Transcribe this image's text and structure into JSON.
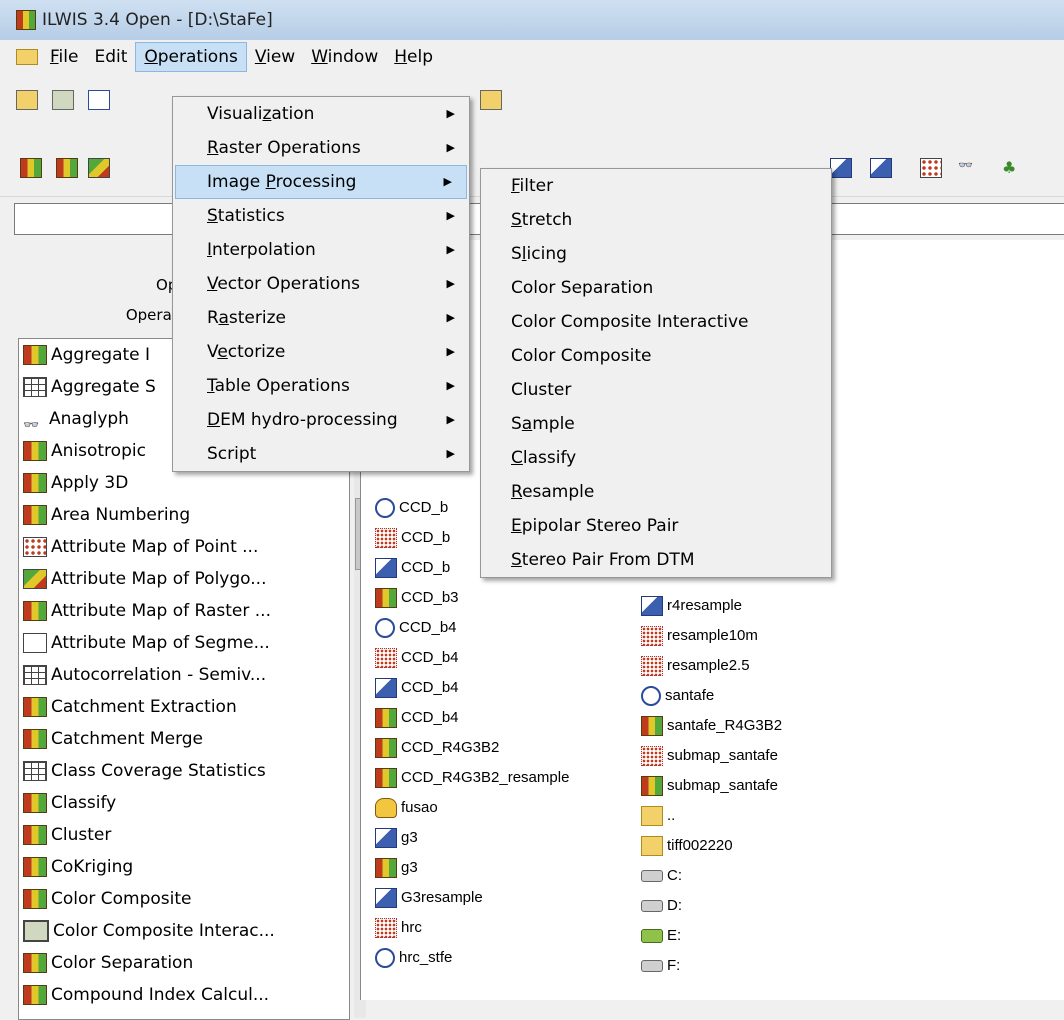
{
  "window": {
    "title": "ILWIS 3.4 Open - [D:\\StaFe]"
  },
  "menubar": [
    {
      "label": "File",
      "u": "F"
    },
    {
      "label": "Edit",
      "u": ""
    },
    {
      "label": "Operations",
      "u": "O"
    },
    {
      "label": "View",
      "u": "V"
    },
    {
      "label": "Window",
      "u": "W"
    },
    {
      "label": "Help",
      "u": "H"
    }
  ],
  "left_panel": {
    "title_partial": "Opera",
    "subtitle_partial": "Operation-List",
    "items": [
      {
        "label": "Aggregate I",
        "icon": "raster-icon"
      },
      {
        "label": "Aggregate S",
        "icon": "table-icon"
      },
      {
        "label": "Anaglyph",
        "icon": "glasses-icon"
      },
      {
        "label": "Anisotropic",
        "icon": "raster-icon"
      },
      {
        "label": "Apply 3D",
        "icon": "raster-icon"
      },
      {
        "label": "Area Numbering",
        "icon": "raster-icon"
      },
      {
        "label": "Attribute Map of Point ...",
        "icon": "point-icon"
      },
      {
        "label": "Attribute Map of Polygo...",
        "icon": "polygon-icon"
      },
      {
        "label": "Attribute Map of Raster ...",
        "icon": "raster-icon"
      },
      {
        "label": "Attribute Map of Segme...",
        "icon": "segment-icon"
      },
      {
        "label": "Autocorrelation - Semiv...",
        "icon": "table-icon"
      },
      {
        "label": "Catchment Extraction",
        "icon": "raster-icon"
      },
      {
        "label": "Catchment Merge",
        "icon": "raster-icon"
      },
      {
        "label": "Class Coverage Statistics",
        "icon": "table-icon"
      },
      {
        "label": "Classify",
        "icon": "raster-icon"
      },
      {
        "label": "Cluster",
        "icon": "raster-icon"
      },
      {
        "label": "CoKriging",
        "icon": "raster-icon"
      },
      {
        "label": "Color Composite",
        "icon": "raster-icon"
      },
      {
        "label": "Color Composite Interac...",
        "icon": "monitor-icon"
      },
      {
        "label": "Color Separation",
        "icon": "raster-icon"
      },
      {
        "label": "Compound Index Calcul...",
        "icon": "raster-icon"
      }
    ]
  },
  "catalog": {
    "col1": [
      {
        "label": "CCD_b",
        "icon": "georef-icon"
      },
      {
        "label": "CCD_b",
        "icon": "pattern-icon"
      },
      {
        "label": "CCD_b",
        "icon": "dem-icon"
      },
      {
        "label": "CCD_b3",
        "icon": "raster-icon"
      },
      {
        "label": "CCD_b4",
        "icon": "georef-icon"
      },
      {
        "label": "CCD_b4",
        "icon": "pattern-icon"
      },
      {
        "label": "CCD_b4",
        "icon": "dem-icon"
      },
      {
        "label": "CCD_b4",
        "icon": "raster-icon"
      },
      {
        "label": "CCD_R4G3B2",
        "icon": "raster-icon"
      },
      {
        "label": "CCD_R4G3B2_resample",
        "icon": "raster-icon"
      },
      {
        "label": "fusao",
        "icon": "mapview-icon"
      },
      {
        "label": "g3",
        "icon": "dem-icon"
      },
      {
        "label": "g3",
        "icon": "raster-icon"
      },
      {
        "label": "G3resample",
        "icon": "dem-icon"
      },
      {
        "label": "hrc",
        "icon": "pattern-icon"
      },
      {
        "label": "hrc_stfe",
        "icon": "georef-icon"
      }
    ],
    "col2": [
      {
        "label": "r4resample",
        "icon": "dem-icon"
      },
      {
        "label": "resample10m",
        "icon": "pattern-icon"
      },
      {
        "label": "resample2.5",
        "icon": "pattern-icon"
      },
      {
        "label": "santafe",
        "icon": "georef-icon"
      },
      {
        "label": "santafe_R4G3B2",
        "icon": "raster-icon"
      },
      {
        "label": "submap_santafe",
        "icon": "pattern-icon"
      },
      {
        "label": "submap_santafe",
        "icon": "raster-icon"
      },
      {
        "label": "..",
        "icon": "folder-icon"
      },
      {
        "label": "tiff002220",
        "icon": "folder-icon"
      },
      {
        "label": "C:",
        "icon": "drive-icon"
      },
      {
        "label": "D:",
        "icon": "drive-icon"
      },
      {
        "label": "E:",
        "icon": "network-drive-icon"
      },
      {
        "label": "F:",
        "icon": "drive-icon"
      }
    ]
  },
  "operations_menu": [
    {
      "label": "Visualization",
      "u": "z",
      "submenu": true
    },
    {
      "label": "Raster Operations",
      "u": "R",
      "submenu": true
    },
    {
      "label": "Image Processing",
      "u": "P",
      "submenu": true,
      "highlighted": true
    },
    {
      "label": "Statistics",
      "u": "S",
      "submenu": true
    },
    {
      "label": "Interpolation",
      "u": "I",
      "submenu": true
    },
    {
      "label": "Vector Operations",
      "u": "V",
      "submenu": true
    },
    {
      "label": "Rasterize",
      "u": "a",
      "submenu": true
    },
    {
      "label": "Vectorize",
      "u": "e",
      "submenu": true
    },
    {
      "label": "Table Operations",
      "u": "T",
      "submenu": true
    },
    {
      "label": "DEM hydro-processing",
      "u": "D",
      "submenu": true
    },
    {
      "label": "Script",
      "u": "",
      "submenu": true
    }
  ],
  "image_processing_menu": [
    {
      "label": "Filter",
      "u": "F"
    },
    {
      "label": "Stretch",
      "u": "S"
    },
    {
      "label": "Slicing",
      "u": "l"
    },
    {
      "label": "Color Separation",
      "u": ""
    },
    {
      "label": "Color Composite Interactive",
      "u": ""
    },
    {
      "label": "Color Composite",
      "u": ""
    },
    {
      "label": "Cluster",
      "u": ""
    },
    {
      "label": "Sample",
      "u": "a"
    },
    {
      "label": "Classify",
      "u": "C"
    },
    {
      "label": "Resample",
      "u": "R"
    },
    {
      "label": "Epipolar Stereo Pair",
      "u": "E"
    },
    {
      "label": "Stereo Pair From DTM",
      "u": "S"
    }
  ],
  "submenu_arrow": "▶"
}
